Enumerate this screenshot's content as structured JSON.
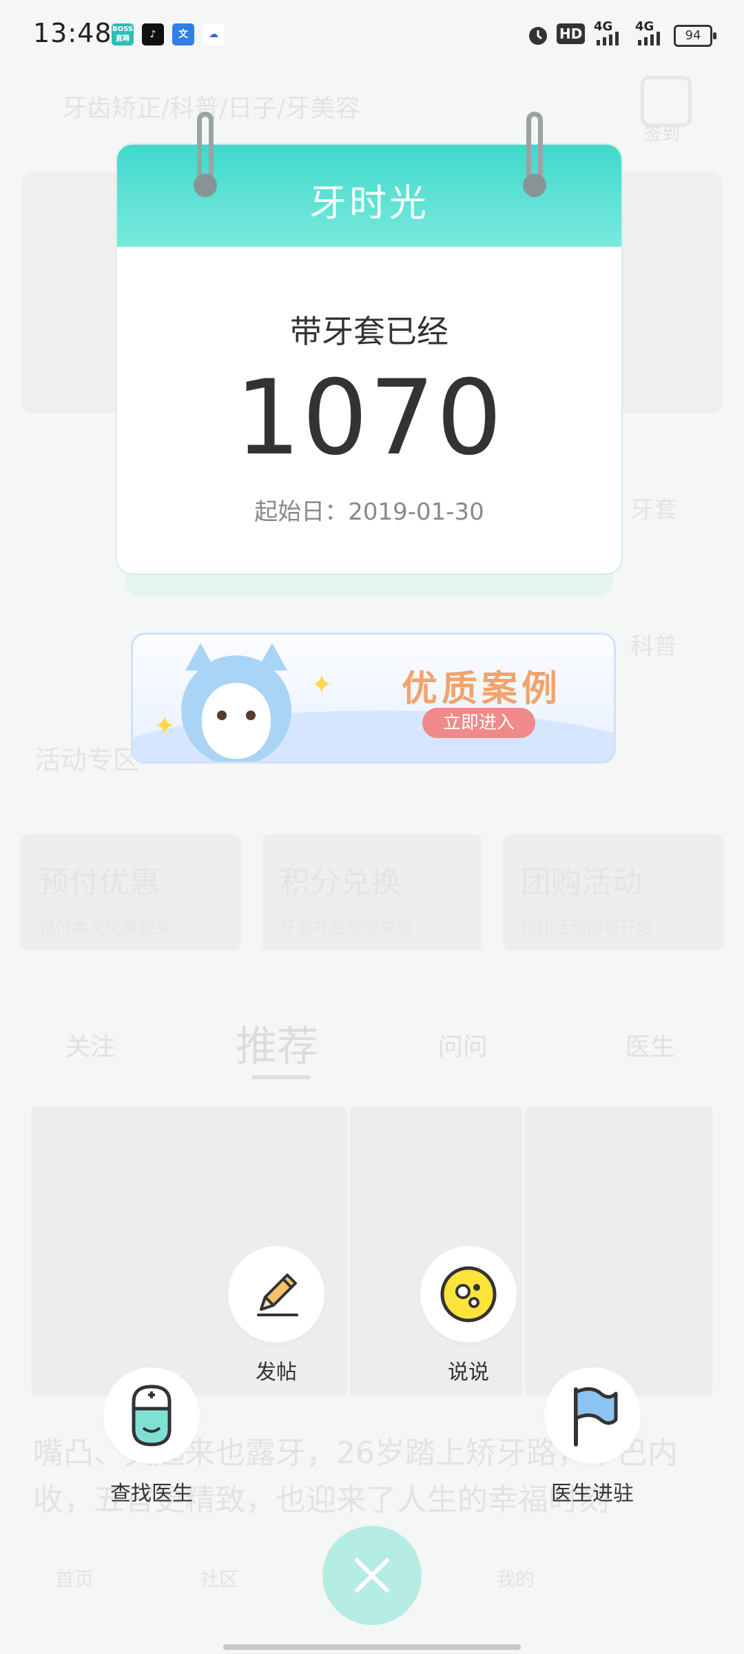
{
  "status_bar": {
    "time": "13:48",
    "app_icons": [
      {
        "name": "boss-zhipin-icon",
        "text": "BOSS直聘",
        "color": "#2bbfb4"
      },
      {
        "name": "tiktok-icon",
        "text": "♪",
        "color": "#111111"
      },
      {
        "name": "translate-icon",
        "text": "文",
        "color": "#2f7fe6"
      },
      {
        "name": "baidu-icon",
        "text": "☁",
        "color": "#ffffff"
      }
    ],
    "hd_label": "HD",
    "network_1": "4G",
    "network_2": "4G",
    "battery": "94"
  },
  "background": {
    "search_placeholder": "牙齿矫正/科普/日子/牙美容",
    "sign_label": "签到",
    "row1_right": "牙套",
    "row2_right": "科普",
    "section_title": "活动专区",
    "promo_cards": [
      {
        "title": "预付优惠",
        "subtitle": "预付本次优惠服务"
      },
      {
        "title": "积分兑换",
        "subtitle": "牙套补贴等你来领"
      },
      {
        "title": "团购活动",
        "subtitle": "抢团活动即将开始"
      }
    ],
    "tabs": [
      "关注",
      "推荐",
      "问问",
      "医生"
    ],
    "headline": "嘴凸、笑起来也露牙，26岁踏上矫牙路，下巴内收，五官更精致，也迎来了人生的幸福时刻",
    "nav": [
      "首页",
      "社区",
      "",
      "我的",
      ""
    ]
  },
  "calendar": {
    "title": "牙时光",
    "label": "带牙套已经",
    "days": "1070",
    "start_prefix": "起始日：",
    "start_date": "2019-01-30",
    "header_color": "#3fd9cc"
  },
  "case_banner": {
    "title": "优质案例",
    "button": "立即进入"
  },
  "actions": {
    "post": "发帖",
    "talk": "说说",
    "find_doctor": "查找医生",
    "doctor_join": "医生进驻"
  }
}
